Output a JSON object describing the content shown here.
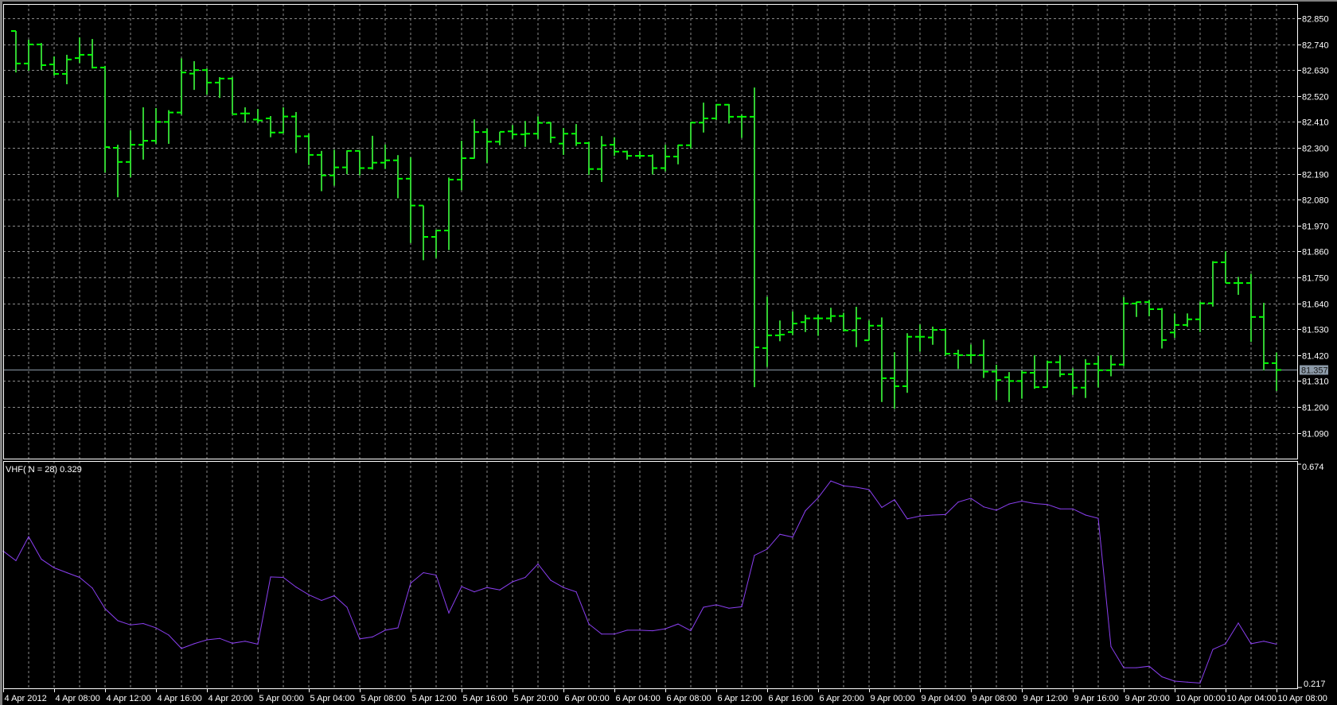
{
  "chart_data": [
    {
      "type": "ohlc",
      "symbol_timeframe": "H1",
      "price_axis": {
        "ticks": [
          "82.850",
          "82.740",
          "82.630",
          "82.520",
          "82.410",
          "82.300",
          "82.190",
          "82.080",
          "81.970",
          "81.860",
          "81.750",
          "81.640",
          "81.530",
          "81.420",
          "81.310",
          "81.200",
          "81.090"
        ],
        "tick_values": [
          82.85,
          82.74,
          82.63,
          82.52,
          82.41,
          82.3,
          82.19,
          82.08,
          81.97,
          81.86,
          81.75,
          81.64,
          81.53,
          81.42,
          81.31,
          81.2,
          81.09
        ]
      },
      "current_price": {
        "value": 81.357,
        "label": "81.357"
      },
      "time_axis": {
        "ticks": [
          "4 Apr 2012",
          "4 Apr 08:00",
          "4 Apr 12:00",
          "4 Apr 16:00",
          "4 Apr 20:00",
          "5 Apr 00:00",
          "5 Apr 04:00",
          "5 Apr 08:00",
          "5 Apr 12:00",
          "5 Apr 16:00",
          "5 Apr 20:00",
          "6 Apr 00:00",
          "6 Apr 04:00",
          "6 Apr 08:00",
          "6 Apr 12:00",
          "6 Apr 16:00",
          "6 Apr 20:00",
          "9 Apr 00:00",
          "9 Apr 04:00",
          "9 Apr 08:00",
          "9 Apr 12:00",
          "9 Apr 16:00",
          "9 Apr 20:00",
          "10 Apr 00:00",
          "10 Apr 04:00",
          "10 Apr 08:00"
        ],
        "bars_per_tick": 4
      },
      "grid": true,
      "bars_ohlc": [
        [
          82.796,
          82.796,
          82.62,
          82.658
        ],
        [
          82.658,
          82.759,
          82.627,
          82.739
        ],
        [
          82.739,
          82.745,
          82.63,
          82.651
        ],
        [
          82.654,
          82.688,
          82.607,
          82.614
        ],
        [
          82.614,
          82.695,
          82.57,
          82.675
        ],
        [
          82.681,
          82.769,
          82.66,
          82.695
        ],
        [
          82.695,
          82.762,
          82.637,
          82.641
        ],
        [
          82.641,
          82.648,
          82.195,
          82.303
        ],
        [
          82.3,
          82.313,
          82.09,
          82.24
        ],
        [
          82.24,
          82.374,
          82.175,
          82.313
        ],
        [
          82.313,
          82.472,
          82.25,
          82.33
        ],
        [
          82.33,
          82.469,
          82.317,
          82.41
        ],
        [
          82.41,
          82.46,
          82.317,
          82.45
        ],
        [
          82.45,
          82.68,
          82.44,
          82.62
        ],
        [
          82.615,
          82.668,
          82.546,
          82.63
        ],
        [
          82.63,
          82.637,
          82.526,
          82.577
        ],
        [
          82.577,
          82.6,
          82.512,
          82.594
        ],
        [
          82.594,
          82.6,
          82.443,
          82.443
        ],
        [
          82.446,
          82.472,
          82.407,
          82.446
        ],
        [
          82.42,
          82.465,
          82.404,
          82.416
        ],
        [
          82.425,
          82.435,
          82.345,
          82.365
        ],
        [
          82.365,
          82.472,
          82.362,
          82.433
        ],
        [
          82.433,
          82.452,
          82.278,
          82.349
        ],
        [
          82.349,
          82.36,
          82.227,
          82.27
        ],
        [
          82.27,
          82.287,
          82.116,
          82.183
        ],
        [
          82.183,
          82.292,
          82.139,
          82.217
        ],
        [
          82.217,
          82.289,
          82.188,
          82.287
        ],
        [
          82.287,
          82.289,
          82.183,
          82.214
        ],
        [
          82.214,
          82.351,
          82.208,
          82.237
        ],
        [
          82.237,
          82.314,
          82.21,
          82.247
        ],
        [
          82.247,
          82.269,
          82.086,
          82.169
        ],
        [
          82.169,
          82.26,
          81.896,
          82.055
        ],
        [
          82.055,
          82.055,
          81.823,
          81.922
        ],
        [
          81.922,
          81.951,
          81.832,
          81.949
        ],
        [
          81.949,
          82.174,
          81.866,
          82.165
        ],
        [
          82.165,
          82.33,
          82.12,
          82.256
        ],
        [
          82.256,
          82.421,
          82.254,
          82.367
        ],
        [
          82.367,
          82.382,
          82.236,
          82.326
        ],
        [
          82.326,
          82.368,
          82.311,
          82.368
        ],
        [
          82.37,
          82.397,
          82.338,
          82.357
        ],
        [
          82.357,
          82.414,
          82.304,
          82.36
        ],
        [
          82.36,
          82.434,
          82.338,
          82.406
        ],
        [
          82.406,
          82.41,
          82.321,
          82.344
        ],
        [
          82.318,
          82.384,
          82.27,
          82.36
        ],
        [
          82.36,
          82.401,
          82.308,
          82.32
        ],
        [
          82.32,
          82.326,
          82.185,
          82.21
        ],
        [
          82.21,
          82.35,
          82.155,
          82.311
        ],
        [
          82.313,
          82.345,
          82.266,
          82.284
        ],
        [
          82.284,
          82.288,
          82.25,
          82.266
        ],
        [
          82.266,
          82.286,
          82.254,
          82.266
        ],
        [
          82.266,
          82.272,
          82.187,
          82.214
        ],
        [
          82.214,
          82.313,
          82.2,
          82.263
        ],
        [
          82.263,
          82.313,
          82.23,
          82.311
        ],
        [
          82.311,
          82.41,
          82.297,
          82.407
        ],
        [
          82.407,
          82.492,
          82.365,
          82.425
        ],
        [
          82.425,
          82.486,
          82.419,
          82.483
        ],
        [
          82.483,
          82.486,
          82.403,
          82.432
        ],
        [
          82.432,
          82.441,
          82.342,
          82.432
        ],
        [
          82.432,
          82.556,
          81.284,
          81.453
        ],
        [
          81.45,
          81.668,
          81.37,
          81.504
        ],
        [
          81.504,
          81.567,
          81.479,
          81.507
        ],
        [
          81.518,
          81.605,
          81.505,
          81.554
        ],
        [
          81.56,
          81.591,
          81.518,
          81.576
        ],
        [
          81.576,
          81.591,
          81.502,
          81.576
        ],
        [
          81.576,
          81.621,
          81.56,
          81.586
        ],
        [
          81.586,
          81.6,
          81.52,
          81.525
        ],
        [
          81.525,
          81.625,
          81.454,
          81.576
        ],
        [
          81.483,
          81.567,
          81.482,
          81.545
        ],
        [
          81.545,
          81.58,
          81.221,
          81.322
        ],
        [
          81.322,
          81.432,
          81.192,
          81.288
        ],
        [
          81.288,
          81.513,
          81.26,
          81.498
        ],
        [
          81.498,
          81.55,
          81.434,
          81.498
        ],
        [
          81.495,
          81.541,
          81.464,
          81.527
        ],
        [
          81.527,
          81.533,
          81.417,
          81.426
        ],
        [
          81.426,
          81.443,
          81.361,
          81.42
        ],
        [
          81.42,
          81.465,
          81.384,
          81.42
        ],
        [
          81.42,
          81.486,
          81.323,
          81.35
        ],
        [
          81.35,
          81.379,
          81.229,
          81.314
        ],
        [
          81.326,
          81.348,
          81.221,
          81.31
        ],
        [
          81.31,
          81.355,
          81.235,
          81.346
        ],
        [
          81.345,
          81.42,
          81.277,
          81.284
        ],
        [
          81.284,
          81.397,
          81.283,
          81.39
        ],
        [
          81.39,
          81.42,
          81.327,
          81.339
        ],
        [
          81.339,
          81.364,
          81.251,
          81.282
        ],
        [
          81.282,
          81.403,
          81.238,
          81.383
        ],
        [
          81.383,
          81.417,
          81.283,
          81.356
        ],
        [
          81.356,
          81.42,
          81.33,
          81.38
        ],
        [
          81.38,
          81.667,
          81.373,
          81.639
        ],
        [
          81.639,
          81.647,
          81.582,
          81.645
        ],
        [
          81.645,
          81.654,
          81.585,
          81.615
        ],
        [
          81.615,
          81.62,
          81.448,
          81.484
        ],
        [
          81.516,
          81.597,
          81.493,
          81.548
        ],
        [
          81.548,
          81.597,
          81.54,
          81.572
        ],
        [
          81.572,
          81.647,
          81.518,
          81.64
        ],
        [
          81.64,
          81.819,
          81.626,
          81.814
        ],
        [
          81.814,
          81.861,
          81.726,
          81.726
        ],
        [
          81.726,
          81.752,
          81.676,
          81.726
        ],
        [
          81.726,
          81.765,
          81.476,
          81.582
        ],
        [
          81.582,
          81.642,
          81.355,
          81.386
        ],
        [
          81.386,
          81.431,
          81.268,
          81.357
        ]
      ],
      "colors": {
        "bar": "#32cd32",
        "bar_tick": "#00ff00",
        "grid": "#8a8a8a",
        "current_price_line": "#8c9aa8",
        "axis": "#ffffff"
      }
    },
    {
      "type": "line",
      "indicator_label": "VHF( N = 28) 0.329",
      "y_axis": {
        "ticks": [
          "0.674",
          "0.217"
        ],
        "tick_values": [
          0.674,
          0.217
        ]
      },
      "first_point_bar_offset": -1,
      "values": [
        0.493,
        0.473,
        0.523,
        0.476,
        0.458,
        0.448,
        0.438,
        0.416,
        0.373,
        0.348,
        0.339,
        0.342,
        0.333,
        0.318,
        0.29,
        0.3,
        0.308,
        0.311,
        0.301,
        0.305,
        0.299,
        0.439,
        0.438,
        0.418,
        0.402,
        0.39,
        0.4,
        0.376,
        0.31,
        0.314,
        0.328,
        0.333,
        0.426,
        0.448,
        0.443,
        0.364,
        0.419,
        0.408,
        0.417,
        0.412,
        0.429,
        0.438,
        0.466,
        0.432,
        0.417,
        0.408,
        0.341,
        0.32,
        0.32,
        0.328,
        0.328,
        0.327,
        0.331,
        0.341,
        0.327,
        0.376,
        0.381,
        0.374,
        0.377,
        0.484,
        0.497,
        0.528,
        0.522,
        0.577,
        0.604,
        0.639,
        0.629,
        0.626,
        0.621,
        0.584,
        0.6,
        0.56,
        0.566,
        0.568,
        0.569,
        0.595,
        0.603,
        0.585,
        0.578,
        0.591,
        0.597,
        0.592,
        0.59,
        0.581,
        0.581,
        0.568,
        0.561,
        0.294,
        0.25,
        0.25,
        0.253,
        0.231,
        0.222,
        0.22,
        0.218,
        0.288,
        0.3,
        0.343,
        0.3,
        0.305,
        0.299
      ],
      "color": "#8a3ff0"
    }
  ]
}
